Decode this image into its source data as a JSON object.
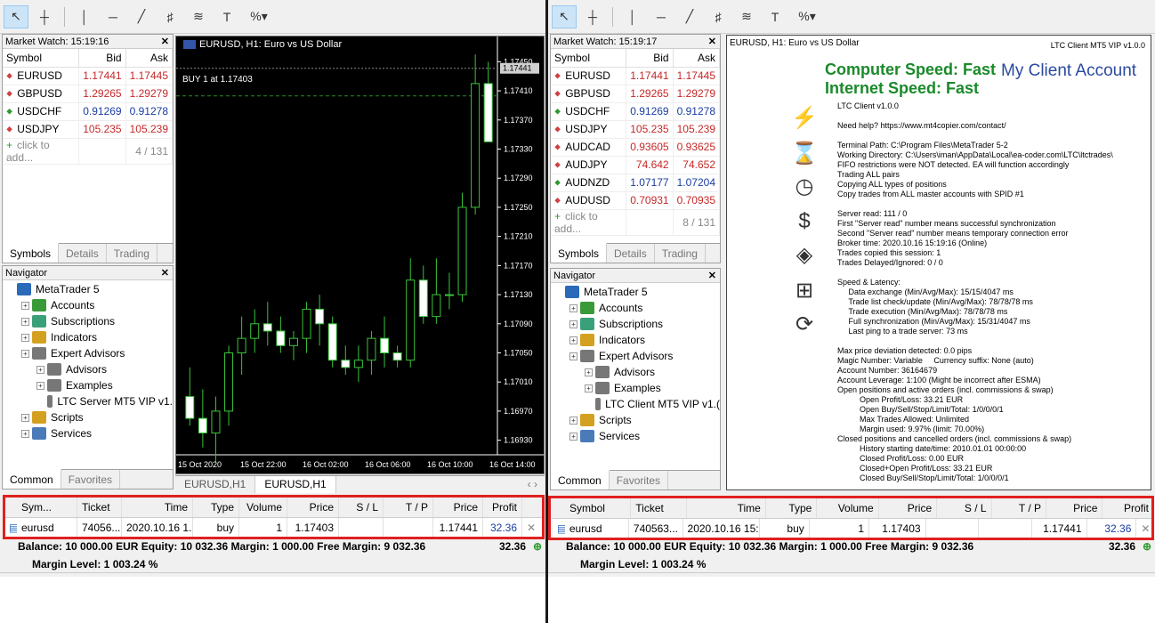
{
  "left": {
    "market_watch": {
      "title": "Market Watch: 15:19:16",
      "headers": {
        "symbol": "Symbol",
        "bid": "Bid",
        "ask": "Ask"
      },
      "rows": [
        {
          "symbol": "EURUSD",
          "bid": "1.17441",
          "ask": "1.17445",
          "dir": "down"
        },
        {
          "symbol": "GBPUSD",
          "bid": "1.29265",
          "ask": "1.29279",
          "dir": "down"
        },
        {
          "symbol": "USDCHF",
          "bid": "0.91269",
          "ask": "0.91278",
          "dir": "up"
        },
        {
          "symbol": "USDJPY",
          "bid": "105.235",
          "ask": "105.239",
          "dir": "down"
        }
      ],
      "add_label": "click to add...",
      "count": "4 / 131",
      "tabs": [
        "Symbols",
        "Details",
        "Trading"
      ]
    },
    "navigator": {
      "title": "Navigator",
      "items": [
        {
          "label": "MetaTrader 5"
        },
        {
          "label": "Accounts"
        },
        {
          "label": "Subscriptions"
        },
        {
          "label": "Indicators"
        },
        {
          "label": "Expert Advisors"
        },
        {
          "label": "Advisors"
        },
        {
          "label": "Examples"
        },
        {
          "label": "LTC Server MT5 VIP v1."
        },
        {
          "label": "Scripts"
        },
        {
          "label": "Services"
        }
      ],
      "tabs": [
        "Common",
        "Favorites"
      ]
    },
    "chart": {
      "title": "EURUSD, H1:  Euro vs US Dollar",
      "order_label": "BUY 1 at 1.17403",
      "price_labels": [
        "1.17450",
        "1.17410",
        "1.17370",
        "1.17330",
        "1.17290",
        "1.17250",
        "1.17210",
        "1.17170",
        "1.17130",
        "1.17090",
        "1.17050",
        "1.17010",
        "1.16970",
        "1.16930"
      ],
      "current_price": "1.17441",
      "time_labels": [
        "15 Oct 2020",
        "15 Oct 22:00",
        "16 Oct 02:00",
        "16 Oct 06:00",
        "16 Oct 10:00",
        "16 Oct 14:00"
      ],
      "tabs": [
        "EURUSD,H1",
        "EURUSD,H1"
      ]
    },
    "trade": {
      "headers": [
        "Sym...",
        "Ticket",
        "Time",
        "Type",
        "Volume",
        "Price",
        "S / L",
        "T / P",
        "Price",
        "Profit"
      ],
      "row": [
        "eurusd",
        "74056...",
        "2020.10.16 1...",
        "buy",
        "1",
        "1.17403",
        "",
        "",
        "1.17441",
        "32.36"
      ],
      "balance": "Balance: 10 000.00 EUR  Equity: 10 032.36  Margin: 1 000.00  Free Margin: 9 032.36",
      "balance_profit": "32.36",
      "margin_level": "Margin Level: 1 003.24 %"
    }
  },
  "right": {
    "market_watch": {
      "title": "Market Watch: 15:19:17",
      "headers": {
        "symbol": "Symbol",
        "bid": "Bid",
        "ask": "Ask"
      },
      "rows": [
        {
          "symbol": "EURUSD",
          "bid": "1.17441",
          "ask": "1.17445",
          "dir": "down"
        },
        {
          "symbol": "GBPUSD",
          "bid": "1.29265",
          "ask": "1.29279",
          "dir": "down"
        },
        {
          "symbol": "USDCHF",
          "bid": "0.91269",
          "ask": "0.91278",
          "dir": "up"
        },
        {
          "symbol": "USDJPY",
          "bid": "105.235",
          "ask": "105.239",
          "dir": "down"
        },
        {
          "symbol": "AUDCAD",
          "bid": "0.93605",
          "ask": "0.93625",
          "dir": "down"
        },
        {
          "symbol": "AUDJPY",
          "bid": "74.642",
          "ask": "74.652",
          "dir": "down"
        },
        {
          "symbol": "AUDNZD",
          "bid": "1.07177",
          "ask": "1.07204",
          "dir": "up"
        },
        {
          "symbol": "AUDUSD",
          "bid": "0.70931",
          "ask": "0.70935",
          "dir": "down"
        }
      ],
      "add_label": "click to add...",
      "count": "8 / 131",
      "tabs": [
        "Symbols",
        "Details",
        "Trading"
      ]
    },
    "navigator": {
      "title": "Navigator",
      "items": [
        {
          "label": "MetaTrader 5"
        },
        {
          "label": "Accounts"
        },
        {
          "label": "Subscriptions"
        },
        {
          "label": "Indicators"
        },
        {
          "label": "Expert Advisors"
        },
        {
          "label": "Advisors"
        },
        {
          "label": "Examples"
        },
        {
          "label": "LTC Client MT5 VIP v1.("
        },
        {
          "label": "Scripts"
        },
        {
          "label": "Services"
        }
      ],
      "tabs": [
        "Common",
        "Favorites"
      ]
    },
    "panel": {
      "title": "EURUSD, H1:  Euro vs US Dollar",
      "version": "LTC Client MT5 VIP v1.0.0",
      "computer_speed": "Computer Speed: Fast",
      "internet_speed": "Internet Speed: Fast",
      "my_account": "My Client Account",
      "lines": [
        "LTC Client v1.0.0",
        "",
        "Need help? https://www.mt4copier.com/contact/",
        "",
        "Terminal Path: C:\\Program Files\\MetaTrader 5-2",
        "Working Directory: C:\\Users\\iman\\AppData\\Local\\ea-coder.com\\LTC\\ltctrades\\",
        "FIFO restrictions were NOT detected. EA will function accordingly",
        "Trading ALL pairs",
        "Copying ALL types of positions",
        "Copy trades from ALL master accounts with SPID #1",
        "",
        "Server read: 111 / 0",
        "First \"Server read\" number means successful synchronization",
        "Second \"Server read\" number means temporary connection error",
        "Broker time: 2020.10.16 15:19:16 (Online)",
        "Trades copied this session: 1",
        "Trades Delayed/Ignored: 0 / 0",
        "",
        "Speed & Latency:",
        "     Data exchange (Min/Avg/Max): 15/15/4047 ms",
        "     Trade list check/update (Min/Avg/Max): 78/78/78 ms",
        "     Trade execution (Min/Avg/Max): 78/78/78 ms",
        "     Full synchronization (Min/Avg/Max): 15/31/4047 ms",
        "     Last ping to a trade server: 73 ms",
        "",
        "Max price deviation detected: 0.0 pips",
        "Magic Number: Variable     Currency suffix: None (auto)",
        "Account Number: 36164679",
        "Account Leverage: 1:100 (Might be incorrect after ESMA)",
        "Open positions and active orders (incl. commissions & swap)",
        "          Open Profit/Loss: 33.21 EUR",
        "          Open Buy/Sell/Stop/Limit/Total: 1/0/0/0/1",
        "          Max Trades Allowed: Unlimited",
        "          Margin used: 9.97% (limit: 70.00%)",
        "Closed positions and cancelled orders (incl. commissions & swap)",
        "          History starting date/time: 2010.01.01 00:00:00",
        "          Closed Profit/Loss: 0.00 EUR",
        "          Closed+Open Profit/Loss: 33.21 EUR",
        "          Closed Buy/Sell/Stop/Limit/Total: 1/0/0/0/1"
      ]
    },
    "trade": {
      "headers": [
        "Symbol",
        "Ticket",
        "Time",
        "Type",
        "Volume",
        "Price",
        "S / L",
        "T / P",
        "Price",
        "Profit"
      ],
      "row": [
        "eurusd",
        "740563...",
        "2020.10.16 15:...",
        "buy",
        "1",
        "1.17403",
        "",
        "",
        "1.17441",
        "32.36"
      ],
      "balance": "Balance: 10 000.00 EUR  Equity: 10 032.36  Margin: 1 000.00  Free Margin: 9 032.36",
      "balance_profit": "32.36",
      "margin_level": "Margin Level: 1 003.24 %"
    }
  },
  "chart_data": {
    "type": "candlestick",
    "symbol": "EURUSD",
    "timeframe": "H1",
    "ylim": [
      1.1691,
      1.1747
    ],
    "candles": [
      {
        "o": 1.1699,
        "h": 1.1703,
        "l": 1.1695,
        "c": 1.1696
      },
      {
        "o": 1.1696,
        "h": 1.17,
        "l": 1.1692,
        "c": 1.1694
      },
      {
        "o": 1.1694,
        "h": 1.1699,
        "l": 1.169,
        "c": 1.1697
      },
      {
        "o": 1.1697,
        "h": 1.1706,
        "l": 1.1695,
        "c": 1.1705
      },
      {
        "o": 1.1705,
        "h": 1.171,
        "l": 1.1702,
        "c": 1.1707
      },
      {
        "o": 1.1707,
        "h": 1.1711,
        "l": 1.1705,
        "c": 1.1709
      },
      {
        "o": 1.1709,
        "h": 1.1712,
        "l": 1.1706,
        "c": 1.1708
      },
      {
        "o": 1.1708,
        "h": 1.171,
        "l": 1.1705,
        "c": 1.1706
      },
      {
        "o": 1.1706,
        "h": 1.1708,
        "l": 1.1704,
        "c": 1.1707
      },
      {
        "o": 1.1707,
        "h": 1.1712,
        "l": 1.1705,
        "c": 1.1711
      },
      {
        "o": 1.1711,
        "h": 1.1713,
        "l": 1.1706,
        "c": 1.1709
      },
      {
        "o": 1.1709,
        "h": 1.171,
        "l": 1.1703,
        "c": 1.1704
      },
      {
        "o": 1.1704,
        "h": 1.1706,
        "l": 1.1702,
        "c": 1.1703
      },
      {
        "o": 1.1703,
        "h": 1.1706,
        "l": 1.1701,
        "c": 1.1704
      },
      {
        "o": 1.1704,
        "h": 1.1708,
        "l": 1.1702,
        "c": 1.1707
      },
      {
        "o": 1.1707,
        "h": 1.171,
        "l": 1.1703,
        "c": 1.1705
      },
      {
        "o": 1.1705,
        "h": 1.1706,
        "l": 1.1703,
        "c": 1.1704
      },
      {
        "o": 1.1704,
        "h": 1.1718,
        "l": 1.1703,
        "c": 1.1715
      },
      {
        "o": 1.1715,
        "h": 1.1717,
        "l": 1.1709,
        "c": 1.171
      },
      {
        "o": 1.171,
        "h": 1.1718,
        "l": 1.1709,
        "c": 1.1713
      },
      {
        "o": 1.1713,
        "h": 1.1716,
        "l": 1.1711,
        "c": 1.1713
      },
      {
        "o": 1.1713,
        "h": 1.1727,
        "l": 1.1712,
        "c": 1.1725
      },
      {
        "o": 1.1725,
        "h": 1.1746,
        "l": 1.1724,
        "c": 1.1742
      },
      {
        "o": 1.1742,
        "h": 1.1745,
        "l": 1.1734,
        "c": 1.1734
      }
    ]
  }
}
